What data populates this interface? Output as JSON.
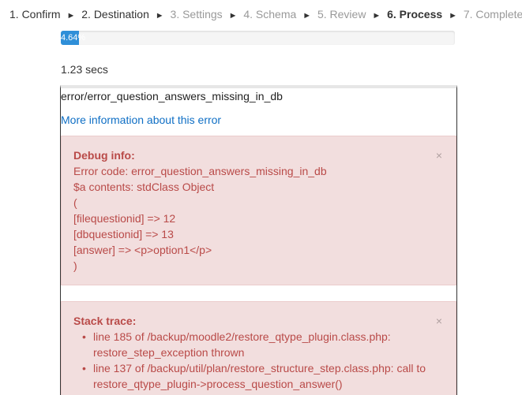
{
  "stepper": {
    "steps": [
      {
        "label": "1. Confirm",
        "state": "done"
      },
      {
        "label": "2. Destination",
        "state": "done"
      },
      {
        "label": "3. Settings",
        "state": "future"
      },
      {
        "label": "4. Schema",
        "state": "future"
      },
      {
        "label": "5. Review",
        "state": "future"
      },
      {
        "label": "6. Process",
        "state": "current"
      },
      {
        "label": "7. Complete",
        "state": "future"
      }
    ],
    "separator": "►"
  },
  "progress": {
    "label": "4.64%",
    "value_percent": 4.64,
    "color": "#2f8fd8"
  },
  "elapsed": "1.23 secs",
  "error": {
    "code_line": "error/error_question_answers_missing_in_db",
    "more_info_link": "More information about this error"
  },
  "debug": {
    "title": "Debug info:",
    "close_glyph": "×",
    "lines": [
      "Error code: error_question_answers_missing_in_db",
      "$a contents: stdClass Object",
      "(",
      "[filequestionid] => 12",
      "[dbquestionid] => 13",
      "[answer] => <p>option1</p>",
      ")"
    ]
  },
  "stack": {
    "title": "Stack trace:",
    "close_glyph": "×",
    "bullet": "•",
    "items": [
      "line 185 of /backup/moodle2/restore_qtype_plugin.class.php: restore_step_exception thrown",
      "line 137 of /backup/util/plan/restore_structure_step.class.php: call to restore_qtype_plugin->process_question_answer()"
    ]
  },
  "colors": {
    "alert_bg": "#f2dede",
    "alert_text": "#b94a48",
    "link": "#0f6fc5"
  }
}
